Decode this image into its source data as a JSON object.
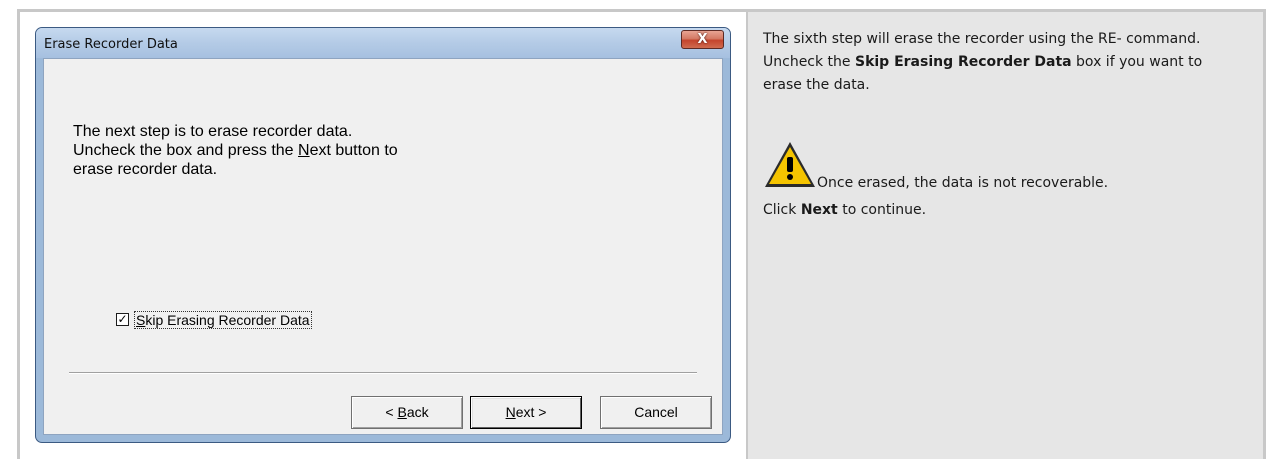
{
  "dialog": {
    "title": "Erase Recorder Data",
    "close_glyph": "X",
    "message": {
      "line1": "The next step is to erase recorder data.",
      "line2_pre": "Uncheck the box and press the ",
      "line2_accel": "N",
      "line2_post": "ext button to",
      "line3": "erase recorder data."
    },
    "checkbox": {
      "checked": true,
      "accel": "S",
      "label_rest": "kip Erasing Recorder Data"
    },
    "buttons": {
      "back_pre": "< ",
      "back_accel": "B",
      "back_post": "ack",
      "next_accel": "N",
      "next_post": "ext >",
      "cancel": "Cancel"
    }
  },
  "instructions": {
    "p1_pre": "The sixth step will erase the recorder using the RE- command. Uncheck the ",
    "p1_bold": "Skip Erasing Recorder Data",
    "p1_post": " box if you want to erase the data.",
    "warning_icon": "warning-triangle-icon",
    "warning_text": "Once erased, the data is not recoverable.",
    "p3_pre": "Click ",
    "p3_bold": "Next",
    "p3_post": " to continue."
  },
  "colors": {
    "right_cell_bg": "#e6e6e6",
    "title_bar": "#b4cbe6",
    "close_button": "#c4442c",
    "warning_yellow": "#f5c400"
  }
}
